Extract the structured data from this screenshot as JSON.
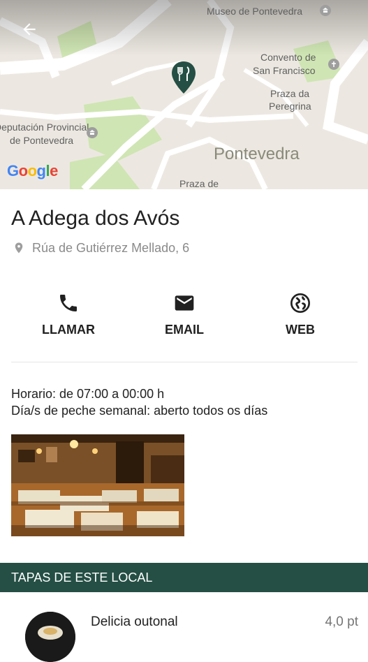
{
  "map": {
    "labels": {
      "museo": "Museo de Pontevedra",
      "convento_1": "Convento de",
      "convento_2": "San Francisco",
      "praza_1": "Praza da",
      "praza_2": "Peregrina",
      "deputacion_1": "Deputación Provincial",
      "deputacion_2": "de Pontevedra",
      "city": "Pontevedra",
      "praza_de": "Praza de"
    },
    "brand": "Google"
  },
  "place": {
    "name": "A Adega dos Avós",
    "address": "Rúa de Gutiérrez Mellado, 6"
  },
  "actions": {
    "call": "LLAMAR",
    "email": "EMAIL",
    "web": "WEB"
  },
  "info": {
    "hours": "Horario: de 07:00 a 00:00 h",
    "closing": "Día/s de peche semanal: aberto todos os días"
  },
  "section": {
    "title": "TAPAS DE ESTE LOCAL"
  },
  "tapas": [
    {
      "name": "Delicia outonal",
      "price": "4,0 pt"
    }
  ],
  "colors": {
    "accent": "#254f44",
    "pin": "#254f44",
    "park": "#cfe5b3",
    "road": "#ffffff"
  }
}
